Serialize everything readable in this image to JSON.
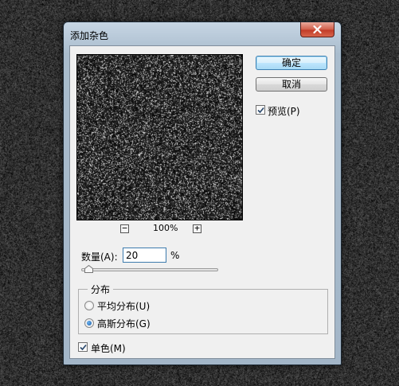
{
  "dialog": {
    "title": "添加杂色",
    "ok_label": "确定",
    "cancel_label": "取消",
    "preview_label": "预览(P)",
    "preview_checked": true,
    "zoom_out_symbol": "−",
    "zoom_in_symbol": "+",
    "zoom_level": "100%",
    "amount_label": "数量(A):",
    "amount_value": "20",
    "amount_unit": "%",
    "amount_fraction": 0.05,
    "distribution": {
      "legend": "分布",
      "options": [
        {
          "label": "平均分布(U)",
          "selected": false
        },
        {
          "label": "高斯分布(G)",
          "selected": true
        }
      ]
    },
    "monochromatic_label": "单色(M)",
    "monochromatic_checked": true
  },
  "icons": {
    "close": "close-icon",
    "check": "checkmark-icon",
    "slider": "slider-thumb-icon"
  },
  "colors": {
    "background": "#3b3b3b",
    "window_frame": "#a9bccd",
    "close_button": "#c23b27",
    "dialog_face": "#f0f0f0",
    "default_button_border": "#3c7fb1"
  }
}
